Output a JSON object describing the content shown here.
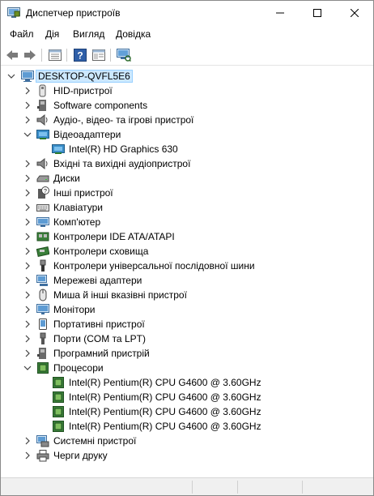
{
  "window": {
    "title": "Диспетчер пристроїв"
  },
  "menu": [
    "Файл",
    "Дія",
    "Вигляд",
    "Довідка"
  ],
  "toolbar": {
    "buttons": [
      "back-icon",
      "forward-icon",
      "properties-icon",
      "help-icon",
      "view-icon",
      "scan-hardware-icon"
    ]
  },
  "tree": {
    "root": "DESKTOP-QVFL5E6",
    "nodes": [
      {
        "label": "HID-пристрої",
        "expanded": false,
        "icon": "hid-icon"
      },
      {
        "label": "Software components",
        "expanded": false,
        "icon": "software-component-icon"
      },
      {
        "label": "Аудіо-, відео- та ігрові пристрої",
        "expanded": false,
        "icon": "speaker-icon"
      },
      {
        "label": "Відеоадаптери",
        "expanded": true,
        "icon": "display-adapter-icon",
        "children": [
          {
            "label": "Intel(R) HD Graphics 630",
            "icon": "display-adapter-icon"
          }
        ]
      },
      {
        "label": "Вхідні та вихідні аудіопристрої",
        "expanded": false,
        "icon": "speaker-icon"
      },
      {
        "label": "Диски",
        "expanded": false,
        "icon": "disk-drive-icon"
      },
      {
        "label": "Інші пристрої",
        "expanded": false,
        "icon": "unknown-device-icon"
      },
      {
        "label": "Клавіатури",
        "expanded": false,
        "icon": "keyboard-icon"
      },
      {
        "label": "Комп'ютер",
        "expanded": false,
        "icon": "computer-icon"
      },
      {
        "label": "Контролери IDE ATA/ATAPI",
        "expanded": false,
        "icon": "ide-controller-icon"
      },
      {
        "label": "Контролери сховища",
        "expanded": false,
        "icon": "storage-controller-icon"
      },
      {
        "label": "Контролери універсальної послідовної шини",
        "expanded": false,
        "icon": "usb-icon"
      },
      {
        "label": "Мережеві адаптери",
        "expanded": false,
        "icon": "network-adapter-icon"
      },
      {
        "label": "Миша й інші вказівні пристрої",
        "expanded": false,
        "icon": "mouse-icon"
      },
      {
        "label": "Монітори",
        "expanded": false,
        "icon": "monitor-icon"
      },
      {
        "label": "Портативні пристрої",
        "expanded": false,
        "icon": "portable-device-icon"
      },
      {
        "label": "Порти (COM та LPT)",
        "expanded": false,
        "icon": "port-icon"
      },
      {
        "label": "Програмний пристрій",
        "expanded": false,
        "icon": "software-device-icon"
      },
      {
        "label": "Процесори",
        "expanded": true,
        "icon": "processor-icon",
        "children": [
          {
            "label": "Intel(R) Pentium(R) CPU G4600 @ 3.60GHz",
            "icon": "processor-icon"
          },
          {
            "label": "Intel(R) Pentium(R) CPU G4600 @ 3.60GHz",
            "icon": "processor-icon"
          },
          {
            "label": "Intel(R) Pentium(R) CPU G4600 @ 3.60GHz",
            "icon": "processor-icon"
          },
          {
            "label": "Intel(R) Pentium(R) CPU G4600 @ 3.60GHz",
            "icon": "processor-icon"
          }
        ]
      },
      {
        "label": "Системні пристрої",
        "expanded": false,
        "icon": "system-device-icon"
      },
      {
        "label": "Черги друку",
        "expanded": false,
        "icon": "printer-icon"
      }
    ]
  },
  "colors": {
    "selection_bg": "#cce8ff",
    "selection_border": "#99d1ff",
    "text": "#000000"
  }
}
